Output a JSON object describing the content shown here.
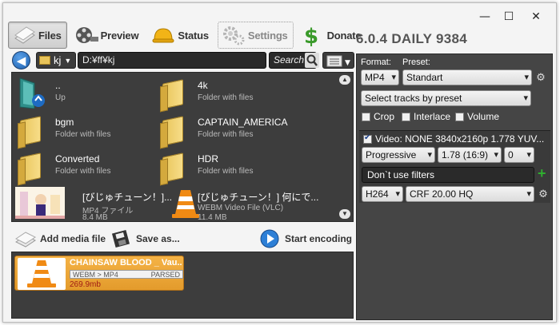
{
  "window": {
    "controls": {
      "minimize": "—",
      "maximize": "☐",
      "close": "✕"
    }
  },
  "toolbar": {
    "items": [
      {
        "label": "Files",
        "icon": "files-icon"
      },
      {
        "label": "Preview",
        "icon": "film-reel-icon"
      },
      {
        "label": "Status",
        "icon": "hardhat-icon"
      },
      {
        "label": "Settings",
        "icon": "gears-icon"
      },
      {
        "label": "Donate",
        "icon": "dollar-icon"
      }
    ]
  },
  "version": "6.0.4 DAILY 9384",
  "nav": {
    "drive": "kj",
    "path": "D:¥ff¥kj",
    "search_placeholder": "Search"
  },
  "browser": {
    "items": [
      {
        "name": "..",
        "sub": "Up",
        "kind": "up"
      },
      {
        "name": "4k",
        "sub": "Folder with files",
        "kind": "folder"
      },
      {
        "name": "bgm",
        "sub": "Folder with files",
        "kind": "folder"
      },
      {
        "name": "CAPTAIN_AMERICA",
        "sub": "Folder with files",
        "kind": "folder"
      },
      {
        "name": "Converted",
        "sub": "Folder with files",
        "kind": "folder"
      },
      {
        "name": "HDR",
        "sub": "Folder with files",
        "kind": "folder"
      },
      {
        "name": "[びじゅチューン！]...",
        "sub": "MP4 ファイル",
        "size": "8.4 MB",
        "kind": "thumb"
      },
      {
        "name": "[びじゅチューン！] 何にで...",
        "sub": "WEBM Video File (VLC)",
        "size": "11.4 MB",
        "kind": "vlc"
      }
    ]
  },
  "actions": {
    "add": "Add media file",
    "save": "Save as...",
    "start": "Start encoding"
  },
  "queue": {
    "items": [
      {
        "title": "CHAINSAW BLOOD _ Vau...",
        "conv": "WEBM > MP4",
        "status": "PARSED",
        "size": "269.9mb"
      }
    ]
  },
  "panel": {
    "format_label": "Format:",
    "preset_label": "Preset:",
    "format": "MP4",
    "preset": "Standart",
    "tracks": "Select tracks by preset",
    "crop": "Crop",
    "interlace": "Interlace",
    "volume": "Volume",
    "video_header": "Video: NONE 3840x2160p 1.778 YUV...",
    "scan": "Progressive",
    "aspect": "1.78 (16:9)",
    "rotate": "0",
    "filters": "Don`t use filters",
    "codec": "H264",
    "quality": "CRF 20.00 HQ"
  },
  "colors": {
    "accent_orange": "#f0a83c",
    "panel_dark": "#3d3d3d",
    "size_red": "#a01c14"
  }
}
